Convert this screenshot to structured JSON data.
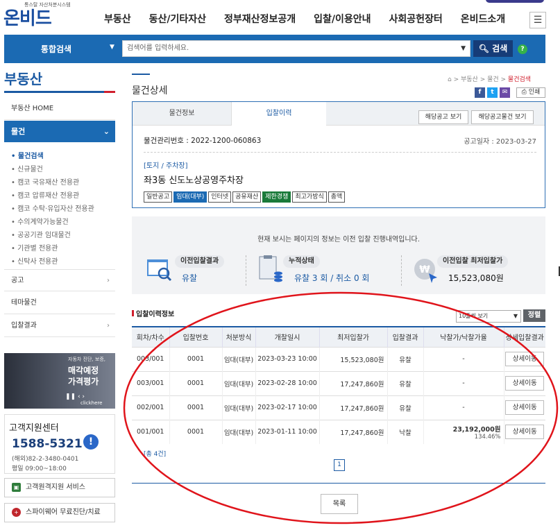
{
  "header": {
    "logo_tagline": "통스탈 자산처분시스템",
    "logo_text": "온비드",
    "nav": [
      "부동산",
      "동산/기타자산",
      "정부재산정보공개",
      "입찰/이용안내",
      "사회공헌장터",
      "온비드소개"
    ],
    "menu_icon": "hamburger-icon"
  },
  "search": {
    "category": "통합검색",
    "placeholder": "검색어를 입력하세요.",
    "button": "검색",
    "help": "?"
  },
  "sidebar": {
    "title": "부동산",
    "home": "부동산 HOME",
    "active_section": "물건",
    "sub_items": [
      {
        "label": "물건검색",
        "active": true
      },
      {
        "label": "신규물건",
        "active": false
      },
      {
        "label": "캠코 국유재산 전용관",
        "active": false
      },
      {
        "label": "캠코 압류재산 전용관",
        "active": false
      },
      {
        "label": "캠코 수탁·유입자산 전용관",
        "active": false
      },
      {
        "label": "수의계약가능물건",
        "active": false
      },
      {
        "label": "공공기관 임대물건",
        "active": false
      },
      {
        "label": "기관별 전용관",
        "active": false
      },
      {
        "label": "신탁사 전용관",
        "active": false
      }
    ],
    "items": [
      "공고",
      "테마물건",
      "입찰결과"
    ],
    "banner": {
      "line1": "자동차 진단, 보증,",
      "line2": "매각예정",
      "line3": "가격평가",
      "click": "clickhere"
    },
    "customer_center": {
      "title": "고객지원센터",
      "phone": "1588-5321",
      "overseas": "(해외)82-2-3480-0401",
      "hours": "평일 09:00~18:00"
    },
    "links": [
      "고객원격지원 서비스",
      "스파이웨어 무료진단/치료"
    ]
  },
  "page": {
    "title": "물건상세",
    "breadcrumb": [
      "부동산",
      "물건",
      "물건검색"
    ],
    "share_icons": [
      "facebook-icon",
      "twitter-icon",
      "mail-icon"
    ],
    "print_label": "인쇄"
  },
  "detail": {
    "tabs": [
      "물건정보",
      "입찰이력"
    ],
    "notice_btn": "해당공고 보기",
    "notice_items_btn": "해당공고물건 보기",
    "mgmt_no": "물건관리번호 : 2022-1200-060863",
    "notice_date": "공고일자 : 2023-03-27",
    "category": "[토지 / 주차장]",
    "name": "좌3동 신도노상공영주차장",
    "tags": [
      {
        "label": "일반공고",
        "style": "plain"
      },
      {
        "label": "임대(대부)",
        "style": "blue"
      },
      {
        "label": "인터넷",
        "style": "plain"
      },
      {
        "label": "공유재산",
        "style": "plain"
      },
      {
        "label": "제한경쟁",
        "style": "green"
      },
      {
        "label": "최고가방식",
        "style": "plain"
      },
      {
        "label": "총액",
        "style": "plain"
      }
    ]
  },
  "info": {
    "message": "현재 보시는 페이지의 정보는 이전 입찰 진행내역입니다.",
    "prev_result_label": "이전입찰결과",
    "prev_result_value": "유찰",
    "cumulative_label": "누적상태",
    "cumulative_value": "유찰 3 회 / 취소 0 회",
    "min_price_label": "이전입찰 최저입찰가",
    "min_price_value": "15,523,080원"
  },
  "history": {
    "title": "입찰이력정보",
    "page_size": "10줄씩 보기",
    "sort_btn": "정렬",
    "columns": [
      "회차/차수",
      "입찰번호",
      "처분방식",
      "개찰일시",
      "최저입찰가",
      "입찰결과",
      "낙찰가/낙찰가율",
      "상세입찰결과"
    ],
    "rows": [
      {
        "round": "003/001",
        "bid_no": "0001",
        "method": "임대(대부)",
        "date": "2023-03-23 10:00",
        "min": "15,523,080원",
        "result": "유찰",
        "award": "-",
        "rate": "",
        "btn": "상세이동"
      },
      {
        "round": "003/001",
        "bid_no": "0001",
        "method": "임대(대부)",
        "date": "2023-02-28 10:00",
        "min": "17,247,860원",
        "result": "유찰",
        "award": "-",
        "rate": "",
        "btn": "상세이동"
      },
      {
        "round": "002/001",
        "bid_no": "0001",
        "method": "임대(대부)",
        "date": "2023-02-17 10:00",
        "min": "17,247,860원",
        "result": "유찰",
        "award": "-",
        "rate": "",
        "btn": "상세이동"
      },
      {
        "round": "001/001",
        "bid_no": "0001",
        "method": "임대(대부)",
        "date": "2023-01-11 10:00",
        "min": "17,247,860원",
        "result": "낙찰",
        "award": "23,192,000원",
        "rate": "134.46%",
        "btn": "상세이동"
      }
    ],
    "total": "[총 4건]",
    "current_page": "1",
    "list_btn": "목록"
  },
  "colors": {
    "brand": "#1b6ab3",
    "accent": "#d0202e",
    "annotation": "#e0141b"
  }
}
